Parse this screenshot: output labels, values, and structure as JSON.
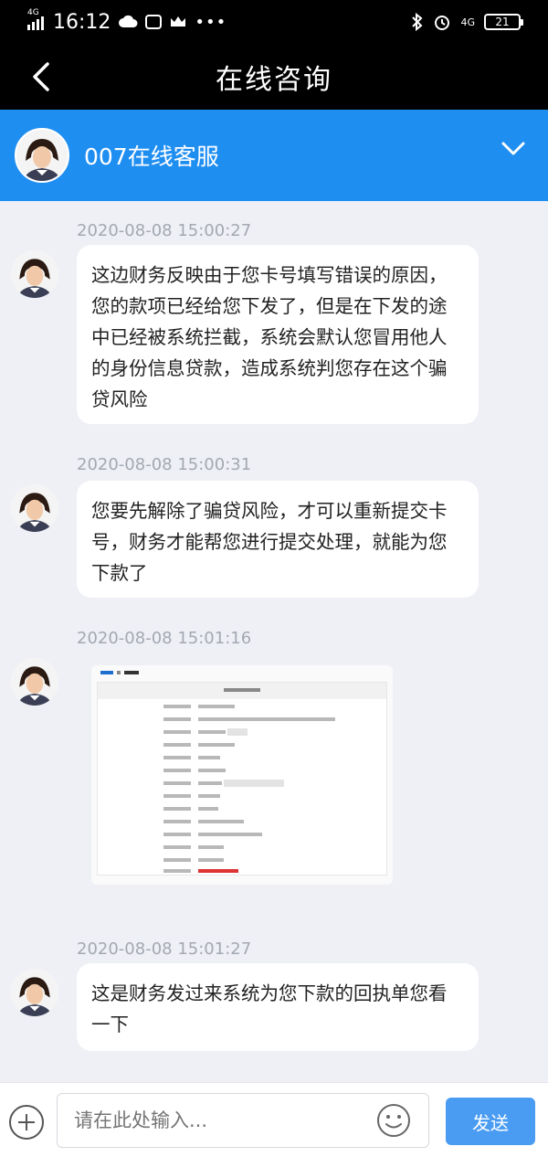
{
  "status_bar": {
    "network": "4G",
    "time": "16:12",
    "dots": "•••",
    "right_network": "4G",
    "battery": "21"
  },
  "nav": {
    "title": "在线咨询"
  },
  "agent": {
    "name": "007在线客服"
  },
  "messages": [
    {
      "timestamp": "2020-08-08 15:00:27",
      "text": "这边财务反映由于您卡号填写错误的原因，您的款项已经给您下发了，但是在下发的途中已经被系统拦截，系统会默认您冒用他人的身份信息贷款，造成系统判您存在这个骗贷风险"
    },
    {
      "timestamp": "2020-08-08 15:00:31",
      "text": "您要先解除了骗贷风险，才可以重新提交卡号，财务才能帮您进行提交处理，就能为您下款了"
    },
    {
      "timestamp": "2020-08-08 15:01:16",
      "image": "transfer-receipt-image"
    },
    {
      "timestamp": "2020-08-08 15:01:27",
      "text": "这是财务发过来系统为您下款的回执单您看一下"
    }
  ],
  "input": {
    "placeholder": "请在此处输入...",
    "send_label": "发送"
  },
  "colors": {
    "header_blue": "#1f8ef1",
    "send_blue": "#4a9cf3",
    "chat_bg": "#eef0f6",
    "timestamp_gray": "#a4a8b0"
  }
}
